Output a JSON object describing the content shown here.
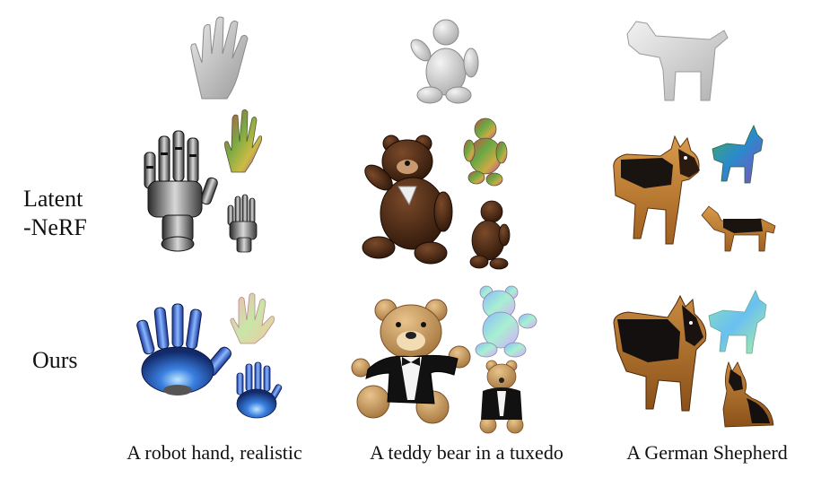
{
  "figure": {
    "row_labels": {
      "latent_nerf_line1": "Latent",
      "latent_nerf_line2": "-NeRF",
      "ours": "Ours"
    },
    "captions": [
      "A robot hand, realistic",
      "A teddy bear in a tuxedo",
      "A German Shepherd"
    ]
  }
}
